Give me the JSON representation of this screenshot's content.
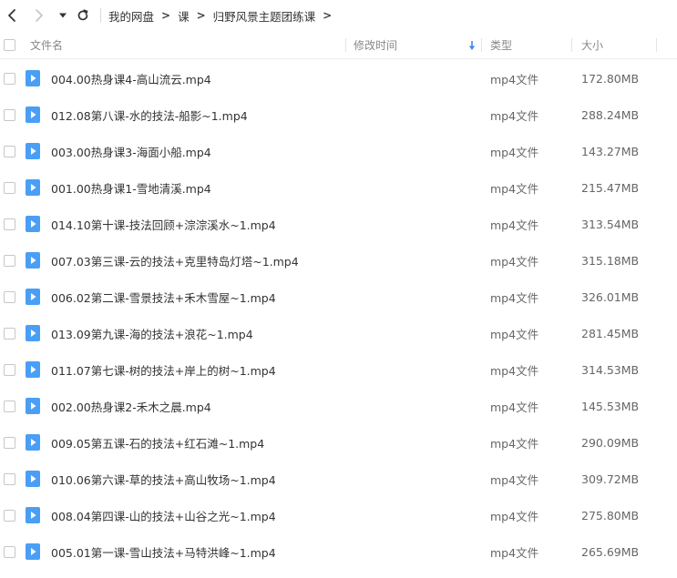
{
  "toolbar": {
    "back_icon": "chevron-left-icon",
    "forward_icon": "chevron-right-icon",
    "dropdown_icon": "caret-down-icon",
    "refresh_icon": "refresh-icon",
    "breadcrumb": [
      "我的网盘",
      "课",
      "归野风景主题团练课"
    ]
  },
  "columns": {
    "name": "文件名",
    "modified": "修改时间",
    "type": "类型",
    "size": "大小",
    "sort_icon": "sort-down-arrow-icon"
  },
  "colors": {
    "file_icon": "#4a9ff5",
    "sort_arrow": "#3b8cf0",
    "text": "#333333",
    "muted": "#888888"
  },
  "files": [
    {
      "name": "004.00热身课4-高山流云.mp4",
      "type": "mp4文件",
      "size": "172.80MB"
    },
    {
      "name": "012.08第八课-水的技法-船影~1.mp4",
      "type": "mp4文件",
      "size": "288.24MB"
    },
    {
      "name": "003.00热身课3-海面小船.mp4",
      "type": "mp4文件",
      "size": "143.27MB"
    },
    {
      "name": "001.00热身课1-雪地清溪.mp4",
      "type": "mp4文件",
      "size": "215.47MB"
    },
    {
      "name": "014.10第十课-技法回顾+淙淙溪水~1.mp4",
      "type": "mp4文件",
      "size": "313.54MB"
    },
    {
      "name": "007.03第三课-云的技法+克里特岛灯塔~1.mp4",
      "type": "mp4文件",
      "size": "315.18MB"
    },
    {
      "name": "006.02第二课-雪景技法+禾木雪屋~1.mp4",
      "type": "mp4文件",
      "size": "326.01MB"
    },
    {
      "name": "013.09第九课-海的技法+浪花~1.mp4",
      "type": "mp4文件",
      "size": "281.45MB"
    },
    {
      "name": "011.07第七课-树的技法+岸上的树~1.mp4",
      "type": "mp4文件",
      "size": "314.53MB"
    },
    {
      "name": "002.00热身课2-禾木之晨.mp4",
      "type": "mp4文件",
      "size": "145.53MB"
    },
    {
      "name": "009.05第五课-石的技法+红石滩~1.mp4",
      "type": "mp4文件",
      "size": "290.09MB"
    },
    {
      "name": "010.06第六课-草的技法+高山牧场~1.mp4",
      "type": "mp4文件",
      "size": "309.72MB"
    },
    {
      "name": "008.04第四课-山的技法+山谷之光~1.mp4",
      "type": "mp4文件",
      "size": "275.80MB"
    },
    {
      "name": "005.01第一课-雪山技法+马特洪峰~1.mp4",
      "type": "mp4文件",
      "size": "265.69MB"
    }
  ]
}
